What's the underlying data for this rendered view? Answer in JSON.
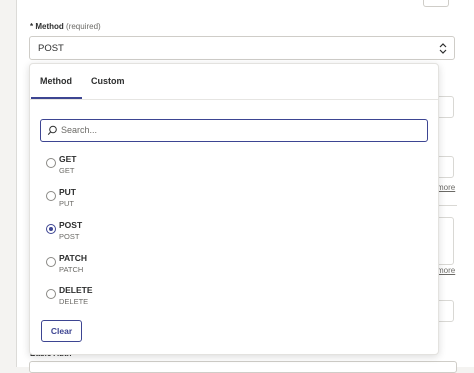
{
  "field": {
    "required_star": "*",
    "label": "Method",
    "required_text": "(required)",
    "value": "POST"
  },
  "tabs": {
    "method": "Method",
    "custom": "Custom"
  },
  "search": {
    "placeholder": "Search..."
  },
  "options": [
    {
      "title": "GET",
      "sub": "GET",
      "selected": false
    },
    {
      "title": "PUT",
      "sub": "PUT",
      "selected": false
    },
    {
      "title": "POST",
      "sub": "POST",
      "selected": true
    },
    {
      "title": "PATCH",
      "sub": "PATCH",
      "selected": false
    },
    {
      "title": "DELETE",
      "sub": "DELETE",
      "selected": false
    }
  ],
  "clear_label": "Clear",
  "background": {
    "more_1": "more",
    "more_2": "more",
    "basic_auth": "Basic Auth"
  },
  "colors": {
    "accent": "#3d4592",
    "text": "#2d2e2e",
    "muted": "#6b6a66",
    "border": "#cfcdc8"
  }
}
